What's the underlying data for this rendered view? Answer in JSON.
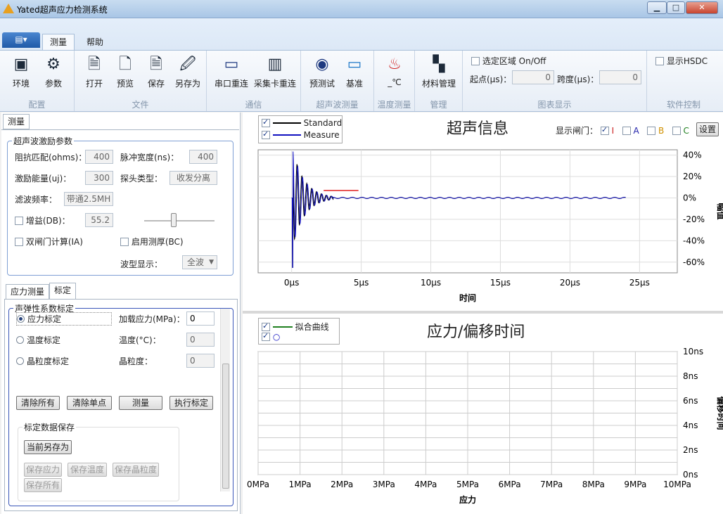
{
  "window": {
    "title": "Yated超声应力检测系统",
    "min": "▁",
    "max": "□",
    "close": "✕"
  },
  "ribbon_tabs": [
    "测量",
    "帮助"
  ],
  "groups": {
    "config": {
      "label": "配置",
      "buttons": [
        "环境",
        "参数"
      ]
    },
    "file": {
      "label": "文件",
      "buttons": [
        "打开",
        "预览",
        "保存",
        "另存为"
      ]
    },
    "comm": {
      "label": "通信",
      "buttons": [
        "串口重连",
        "采集卡重连"
      ]
    },
    "ultra": {
      "label": "超声波测量",
      "buttons": [
        "预测试",
        "基准"
      ]
    },
    "temp": {
      "label": "温度测量",
      "buttons": [
        "_℃"
      ]
    },
    "manage": {
      "label": "管理",
      "buttons": [
        "材料管理"
      ]
    },
    "chartdisp": {
      "label": "图表显示",
      "select_region": "选定区域 On/Off",
      "start_label": "起点(μs)：",
      "start_value": "0",
      "span_label": "跨度(μs)：",
      "span_value": "0"
    },
    "softctl": {
      "label": "软件控制",
      "show_hsdc": "显示HSDC"
    }
  },
  "left": {
    "tab": "测量",
    "excite": {
      "title": "超声波激励参数",
      "impedance_label": "阻抗匹配(ohms)：",
      "impedance": "400",
      "pulse_label": "脉冲宽度(ns)：",
      "pulse": "400",
      "energy_label": "激励能量(uj)：",
      "energy": "300",
      "probe_label": "探头类型：",
      "probe": "收发分离",
      "filter_label": "滤波频率：",
      "filter": "带通2.5MH",
      "gain_label": "增益(DB)：",
      "gain": "55.2",
      "dual_gate": "双闸门计算(IA)",
      "thick": "启用测厚(BC)",
      "wave_label": "波型显示：",
      "wave": "全波"
    },
    "subtabs": [
      "应力测量",
      "标定"
    ],
    "calib": {
      "title": "声弹性系数标定",
      "stress_cal": "应力标定",
      "load_label": "加载应力(MPa)：",
      "load": "0",
      "temp_cal": "温度标定",
      "temp_label": "温度(°C)：",
      "temp": "0",
      "grain_cal": "晶粒度标定",
      "grain_label": "晶粒度：",
      "grain": "0",
      "btn_clear_all": "清除所有",
      "btn_clear_one": "清除单点",
      "btn_measure": "测量",
      "btn_exec": "执行标定",
      "save_title": "标定数据保存",
      "save_current": "当前另存为",
      "save_stress": "保存应力",
      "save_temp": "保存温度",
      "save_grain": "保存晶粒度",
      "save_all": "保存所有"
    }
  },
  "top_chart": {
    "title": "超声信息",
    "legend": [
      "Standard",
      "Measure"
    ],
    "gate_label": "显示闸门：",
    "gates": [
      "I",
      "A",
      "B",
      "C"
    ],
    "gate_colors": [
      "#cc2020",
      "#2020aa",
      "#d09000",
      "#208020"
    ],
    "settings": "设置",
    "xlabel": "时间",
    "ylabel": "幅值",
    "xticks": [
      "0μs",
      "5μs",
      "10μs",
      "15μs",
      "20μs",
      "25μs"
    ],
    "yticks": [
      "40%",
      "20%",
      "0%",
      "-20%",
      "-40%",
      "-60%"
    ]
  },
  "bottom_chart": {
    "title": "应力/偏移时间",
    "legend": [
      "拟合曲线",
      "○"
    ],
    "xlabel": "应力",
    "ylabel": "偏移时间",
    "xticks": [
      "0MPa",
      "1MPa",
      "2MPa",
      "3MPa",
      "4MPa",
      "5MPa",
      "6MPa",
      "7MPa",
      "8MPa",
      "9MPa",
      "10MPa"
    ],
    "yticks": [
      "10ns",
      "8ns",
      "6ns",
      "4ns",
      "2ns",
      "0ns"
    ]
  },
  "chart_data": [
    {
      "type": "line",
      "title": "超声信息",
      "xlabel": "时间",
      "ylabel": "幅值",
      "xlim": [
        0,
        25
      ],
      "ylim": [
        -70,
        45
      ],
      "series": [
        {
          "name": "Standard",
          "color": "#000000"
        },
        {
          "name": "Measure",
          "color": "#1010c0"
        }
      ],
      "gate_I": {
        "x": [
          2.3,
          4.8
        ],
        "y": 7
      }
    },
    {
      "type": "scatter",
      "title": "应力/偏移时间",
      "xlabel": "应力",
      "ylabel": "偏移时间",
      "xlim": [
        0,
        10
      ],
      "ylim": [
        0,
        10
      ],
      "series": [
        {
          "name": "拟合曲线"
        }
      ]
    }
  ]
}
